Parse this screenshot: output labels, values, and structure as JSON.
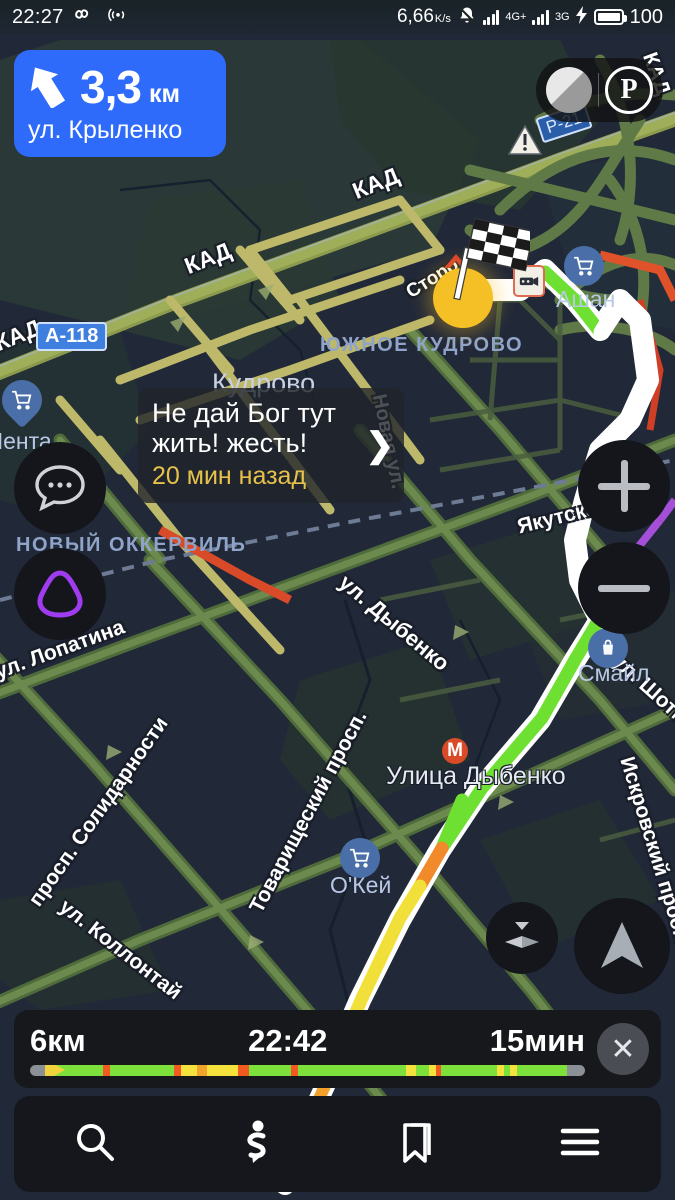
{
  "status_bar": {
    "time": "22:27",
    "infinity_icon": "infinity-icon",
    "cast_icon": "cast-icon",
    "data_speed": "6,66",
    "data_speed_unit_top": "K",
    "data_speed_unit_bottom": "s",
    "dnd_icon": "mute-bell-icon",
    "signal1_icon": "signal-bars-icon",
    "network1_label": "4G+",
    "signal2_icon": "signal-bars-icon",
    "network2_label": "3G",
    "charging_icon": "lightning-bolt-icon",
    "battery_icon": "battery-icon",
    "battery_level": "100"
  },
  "maneuver": {
    "arrow_icon": "turn-left-icon",
    "distance": "3,3",
    "unit": "км",
    "street": "ул. Крыленко",
    "accent_color": "#2f6bfb"
  },
  "top_controls": {
    "layers_icon": "map-layers-icon",
    "parking_icon": "parking-p-icon",
    "parking_label": "P"
  },
  "map_buttons": {
    "chat_icon": "chat-bubble-icon",
    "alice_icon": "alice-assistant-icon",
    "alice_color": "#a03cf0",
    "zoom_in_icon": "plus-icon",
    "zoom_out_icon": "minus-icon",
    "tilt_icon": "tilt-3d-icon",
    "compass_icon": "navigation-arrow-icon"
  },
  "callout": {
    "text_line1": "Не дай Бог тут",
    "text_line2": "жить! жесть!",
    "time_ago": "20 мин назад",
    "time_color": "#e7c24a",
    "chevron_icon": "chevron-right-icon"
  },
  "route_summary": {
    "distance": "6км",
    "eta": "22:42",
    "duration": "15мин",
    "close_icon": "close-x-icon",
    "progress_cursor_icon": "route-cursor-icon",
    "traffic_segments": [
      {
        "color": "#7ee03a",
        "width": 9.5
      },
      {
        "color": "#f35a22",
        "width": 1.4
      },
      {
        "color": "#7ee03a",
        "width": 12.5
      },
      {
        "color": "#f35a22",
        "width": 1.3
      },
      {
        "color": "#f5e23c",
        "width": 3.2
      },
      {
        "color": "#f0a52a",
        "width": 2.0
      },
      {
        "color": "#f5e23c",
        "width": 6.0
      },
      {
        "color": "#f35a22",
        "width": 2.2
      },
      {
        "color": "#7ee03a",
        "width": 8.0
      },
      {
        "color": "#f35a22",
        "width": 1.4
      },
      {
        "color": "#7ee03a",
        "width": 21.0
      },
      {
        "color": "#f5e23c",
        "width": 2.0
      },
      {
        "color": "#7ee03a",
        "width": 2.5
      },
      {
        "color": "#f5e23c",
        "width": 1.4
      },
      {
        "color": "#f35a22",
        "width": 1.0
      },
      {
        "color": "#7ee03a",
        "width": 11.0
      },
      {
        "color": "#f5e23c",
        "width": 1.2
      },
      {
        "color": "#7ee03a",
        "width": 1.3
      },
      {
        "color": "#f5e23c",
        "width": 1.4
      },
      {
        "color": "#7ee03a",
        "width": 9.7
      }
    ]
  },
  "bottom_nav": {
    "search_icon": "search-icon",
    "route_icon": "route-navigation-icon",
    "bookmark_icon": "bookmark-icon",
    "menu_icon": "hamburger-menu-icon"
  },
  "map_labels": {
    "kad_top": "КАД",
    "kad_left": "КАД",
    "kad_edge": "КАД",
    "kad_right": "КАД",
    "shield_a118": "A-118",
    "city_kudrovo": "Кудрово",
    "district_south_kudrovo": "ЮЖНОЕ КУДРОВО",
    "district_novy_okkervil": "НОВЫЙ ОККЕРВИЛЬ",
    "street_novaya": "Новая ул.",
    "street_yakutskaya": "Якутская ул.",
    "street_lopatina": "ул. Лопатина",
    "street_dybenko": "ул. Дыбенко",
    "street_shotmana": "ул. Шотмана",
    "street_solidarnosti": "просп. Солидарности",
    "street_tovarishchesky": "Товарищеский просп.",
    "street_kollontay": "ул. Коллонтай",
    "street_iskrovsky": "Искровский просп.",
    "street_stop": "Сторо",
    "metro_dybenko": "Улица Дыбенко",
    "poi_ashan": "Ашан",
    "poi_lenta": "Лента",
    "poi_smile": "Смайл",
    "poi_okey": "О'Кей",
    "sign_p21": "P-21",
    "warning_icon": "warning-triangle-icon",
    "camera_icon": "speed-camera-icon",
    "flag_icon": "checkered-flag-icon",
    "cart_icon": "shopping-cart-icon",
    "bag_icon": "shopping-bag-icon",
    "metro_icon": "metro-m-icon"
  }
}
